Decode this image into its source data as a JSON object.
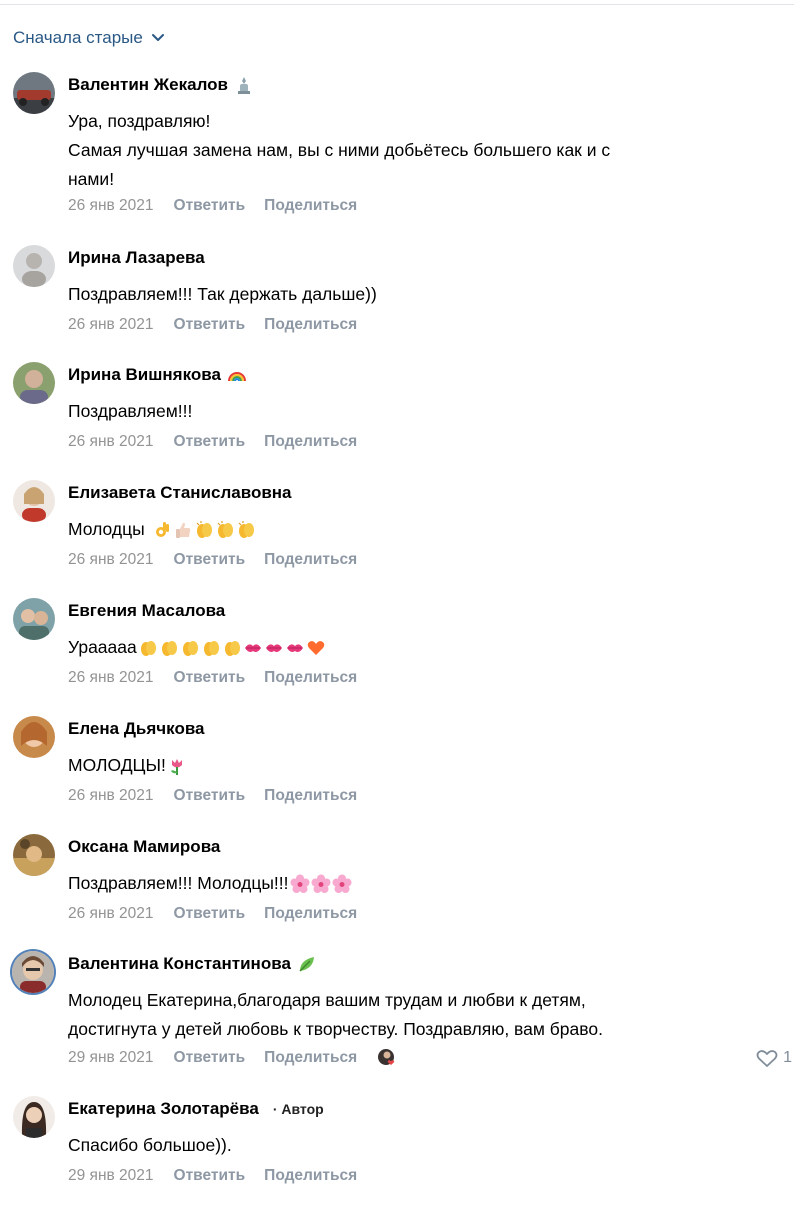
{
  "sort": {
    "label": "Сначала старые"
  },
  "comments": [
    {
      "author": "Валентин Жекалов",
      "lines": [
        "Ура, поздравляю!",
        "Самая лучшая замена нам, вы с ними добьётесь большего как и с",
        "нами!"
      ],
      "date": "26 янв 2021",
      "reply": "Ответить",
      "share": "Поделиться"
    },
    {
      "author": "Ирина Лазарева",
      "lines": [
        "Поздравляем!!! Так держать дальше))"
      ],
      "date": "26 янв 2021",
      "reply": "Ответить",
      "share": "Поделиться"
    },
    {
      "author": "Ирина Вишнякова",
      "lines": [
        "Поздравляем!!!"
      ],
      "date": "26 янв 2021",
      "reply": "Ответить",
      "share": "Поделиться"
    },
    {
      "author": "Елизавета Станиславовна",
      "lines": [
        "Молодцы"
      ],
      "date": "26 янв 2021",
      "reply": "Ответить",
      "share": "Поделиться"
    },
    {
      "author": "Евгения Масалова",
      "lines": [
        "Урааааа"
      ],
      "date": "26 янв 2021",
      "reply": "Ответить",
      "share": "Поделиться"
    },
    {
      "author": "Елена Дьячкова",
      "lines": [
        "МОЛОДЦЫ!"
      ],
      "date": "26 янв 2021",
      "reply": "Ответить",
      "share": "Поделиться"
    },
    {
      "author": "Оксана Мамирова",
      "lines": [
        "Поздравляем!!! Молодцы!!!"
      ],
      "date": "26 янв 2021",
      "reply": "Ответить",
      "share": "Поделиться"
    },
    {
      "author": "Валентина Константинова",
      "lines": [
        "Молодец Екатерина,благодаря вашим трудам и любви к детям,",
        "достигнута у детей любовь к творчеству. Поздравляю, вам браво."
      ],
      "date": "29 янв 2021",
      "reply": "Ответить",
      "share": "Поделиться",
      "likes": "1"
    },
    {
      "author": "Екатерина Золотарёва",
      "badge": "· Автор",
      "lines": [
        "Спасибо большое))."
      ],
      "date": "29 янв 2021",
      "reply": "Ответить",
      "share": "Поделиться"
    }
  ],
  "colors": {
    "link": "#2a5885",
    "meta": "#818c99",
    "heart": "#e64646"
  }
}
